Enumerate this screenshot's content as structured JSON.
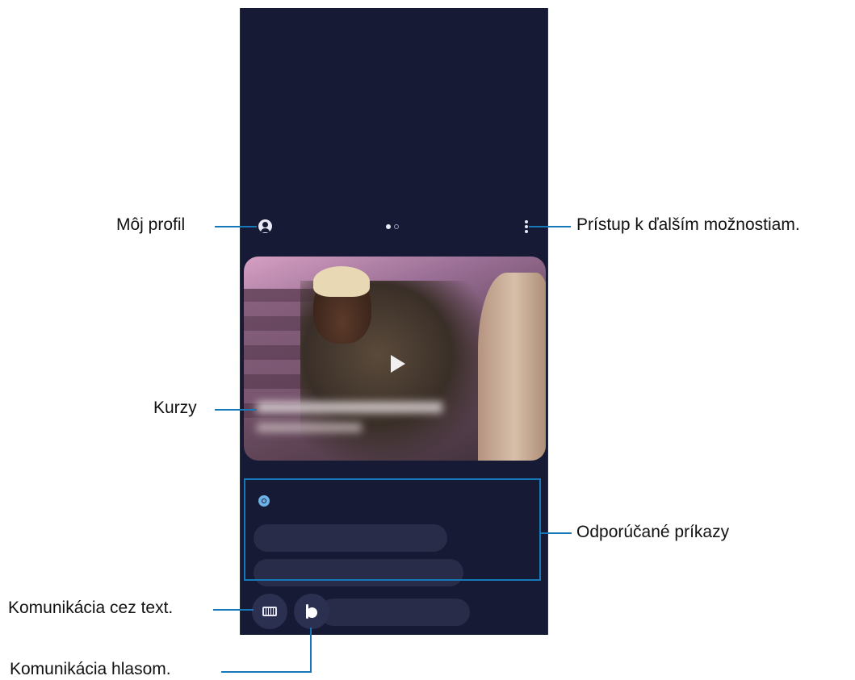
{
  "callouts": {
    "profile": "Môj profil",
    "more_options": "Prístup k ďalším možnostiam.",
    "tutorials": "Kurzy",
    "suggested_commands": "Odporúčané príkazy",
    "text_communication": "Komunikácia cez text.",
    "voice_communication": "Komunikácia hlasom."
  },
  "icons": {
    "profile": "profile-icon",
    "more": "more-options-icon",
    "play": "play-icon",
    "keyboard": "keyboard-icon",
    "bixby": "bixby-icon"
  },
  "colors": {
    "callout_line": "#1677b9",
    "screen_background": "#171a35",
    "chip_background": "#282c48"
  }
}
